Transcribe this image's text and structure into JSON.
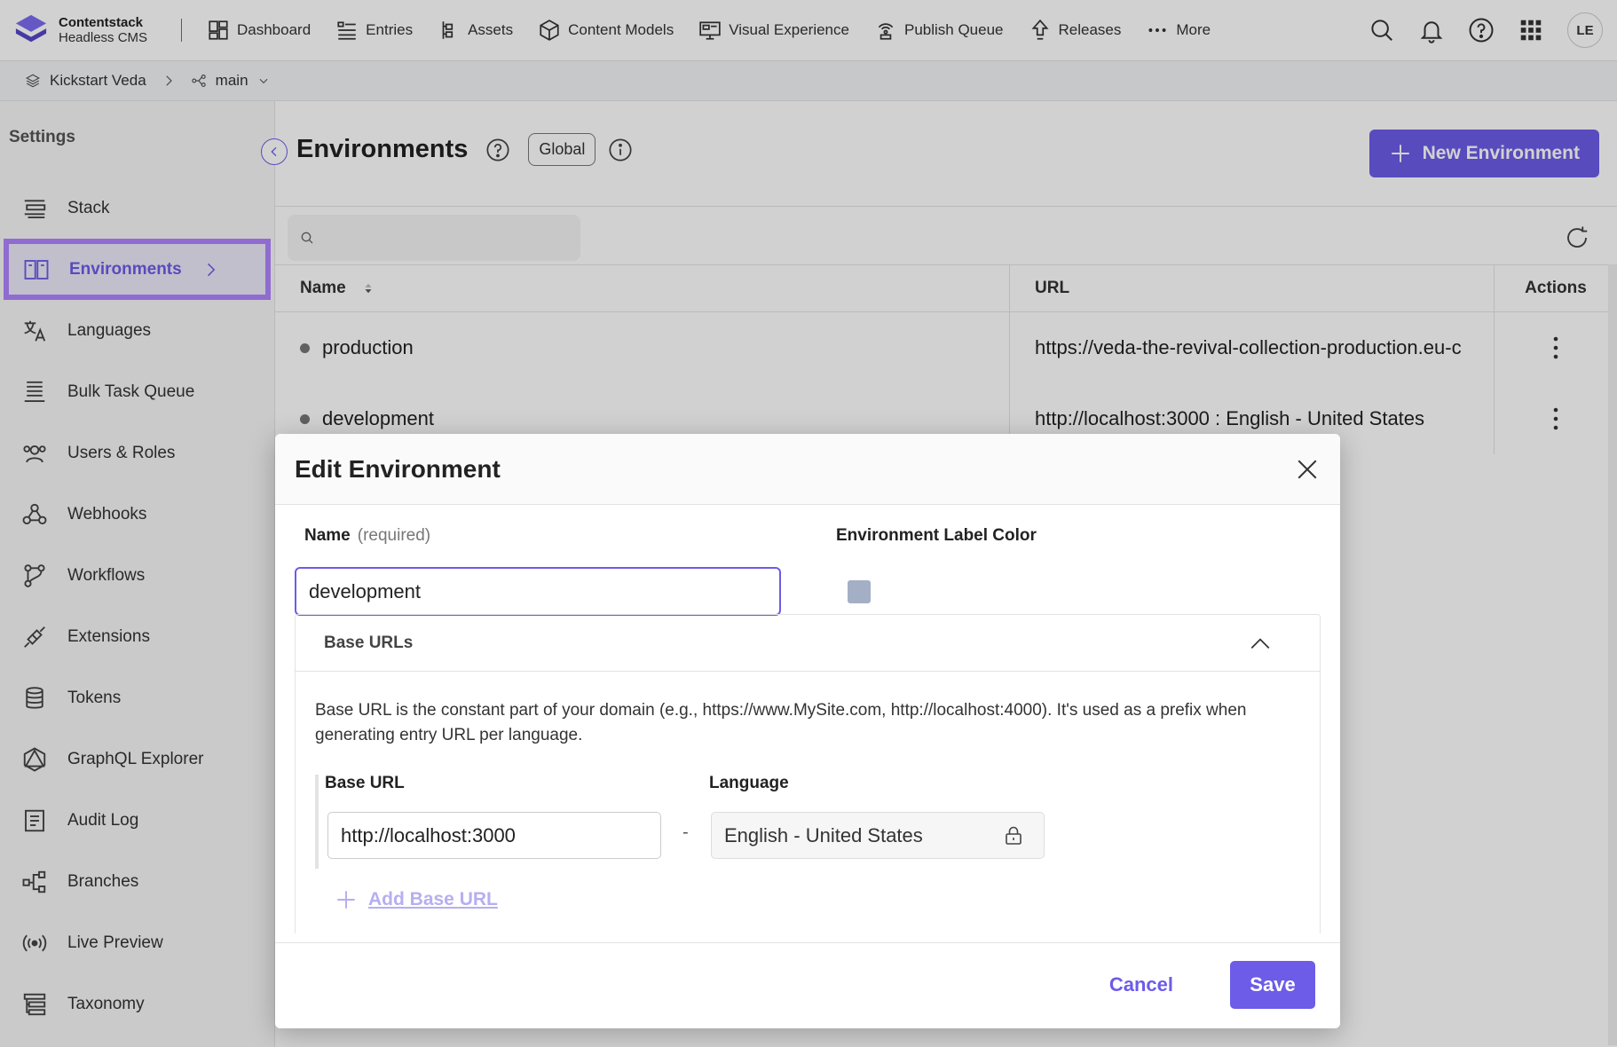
{
  "brand": {
    "name": "Contentstack",
    "subtitle": "Headless CMS",
    "accent": "#6c5ce7"
  },
  "nav": {
    "items": [
      {
        "label": "Dashboard",
        "icon": "dashboard-icon"
      },
      {
        "label": "Entries",
        "icon": "entries-icon"
      },
      {
        "label": "Assets",
        "icon": "assets-icon"
      },
      {
        "label": "Content Models",
        "icon": "content-models-icon"
      },
      {
        "label": "Visual Experience",
        "icon": "visual-experience-icon"
      },
      {
        "label": "Publish Queue",
        "icon": "publish-queue-icon"
      },
      {
        "label": "Releases",
        "icon": "releases-icon"
      },
      {
        "label": "More",
        "icon": "more-icon"
      }
    ],
    "user_initials": "LE"
  },
  "breadcrumb": {
    "stack": "Kickstart Veda",
    "branch": "main"
  },
  "sidebar": {
    "title": "Settings",
    "items": [
      {
        "label": "Stack",
        "icon": "stack-icon"
      },
      {
        "label": "Environments",
        "icon": "environments-icon",
        "active": true
      },
      {
        "label": "Languages",
        "icon": "languages-icon"
      },
      {
        "label": "Bulk Task Queue",
        "icon": "bulk-task-queue-icon"
      },
      {
        "label": "Users & Roles",
        "icon": "users-roles-icon"
      },
      {
        "label": "Webhooks",
        "icon": "webhooks-icon"
      },
      {
        "label": "Workflows",
        "icon": "workflows-icon"
      },
      {
        "label": "Extensions",
        "icon": "extensions-icon"
      },
      {
        "label": "Tokens",
        "icon": "tokens-icon"
      },
      {
        "label": "GraphQL Explorer",
        "icon": "graphql-icon"
      },
      {
        "label": "Audit Log",
        "icon": "audit-log-icon"
      },
      {
        "label": "Branches",
        "icon": "branches-icon"
      },
      {
        "label": "Live Preview",
        "icon": "live-preview-icon"
      },
      {
        "label": "Taxonomy",
        "icon": "taxonomy-icon"
      }
    ]
  },
  "page": {
    "title": "Environments",
    "scope_badge": "Global",
    "new_button": "New Environment"
  },
  "table": {
    "columns": [
      "Name",
      "URL",
      "Actions"
    ],
    "rows": [
      {
        "name": "production",
        "url": "https://veda-the-revival-collection-production.eu-c"
      },
      {
        "name": "development",
        "url": "http://localhost:3000 : English - United States"
      }
    ]
  },
  "modal": {
    "title": "Edit Environment",
    "name_label": "Name",
    "name_required": "(required)",
    "name_value": "development",
    "color_label": "Environment Label Color",
    "color_value": "#a4afc6",
    "base_urls_title": "Base URLs",
    "base_urls_description": "Base URL is the constant part of your domain (e.g., https://www.MySite.com, http://localhost:4000). It's used as a prefix when generating entry URL per language.",
    "base_url_label": "Base URL",
    "language_label": "Language",
    "base_url_value": "http://localhost:3000",
    "separator": "-",
    "language_value": "English - United States",
    "add_base_url": "Add Base URL",
    "cancel": "Cancel",
    "save": "Save"
  }
}
